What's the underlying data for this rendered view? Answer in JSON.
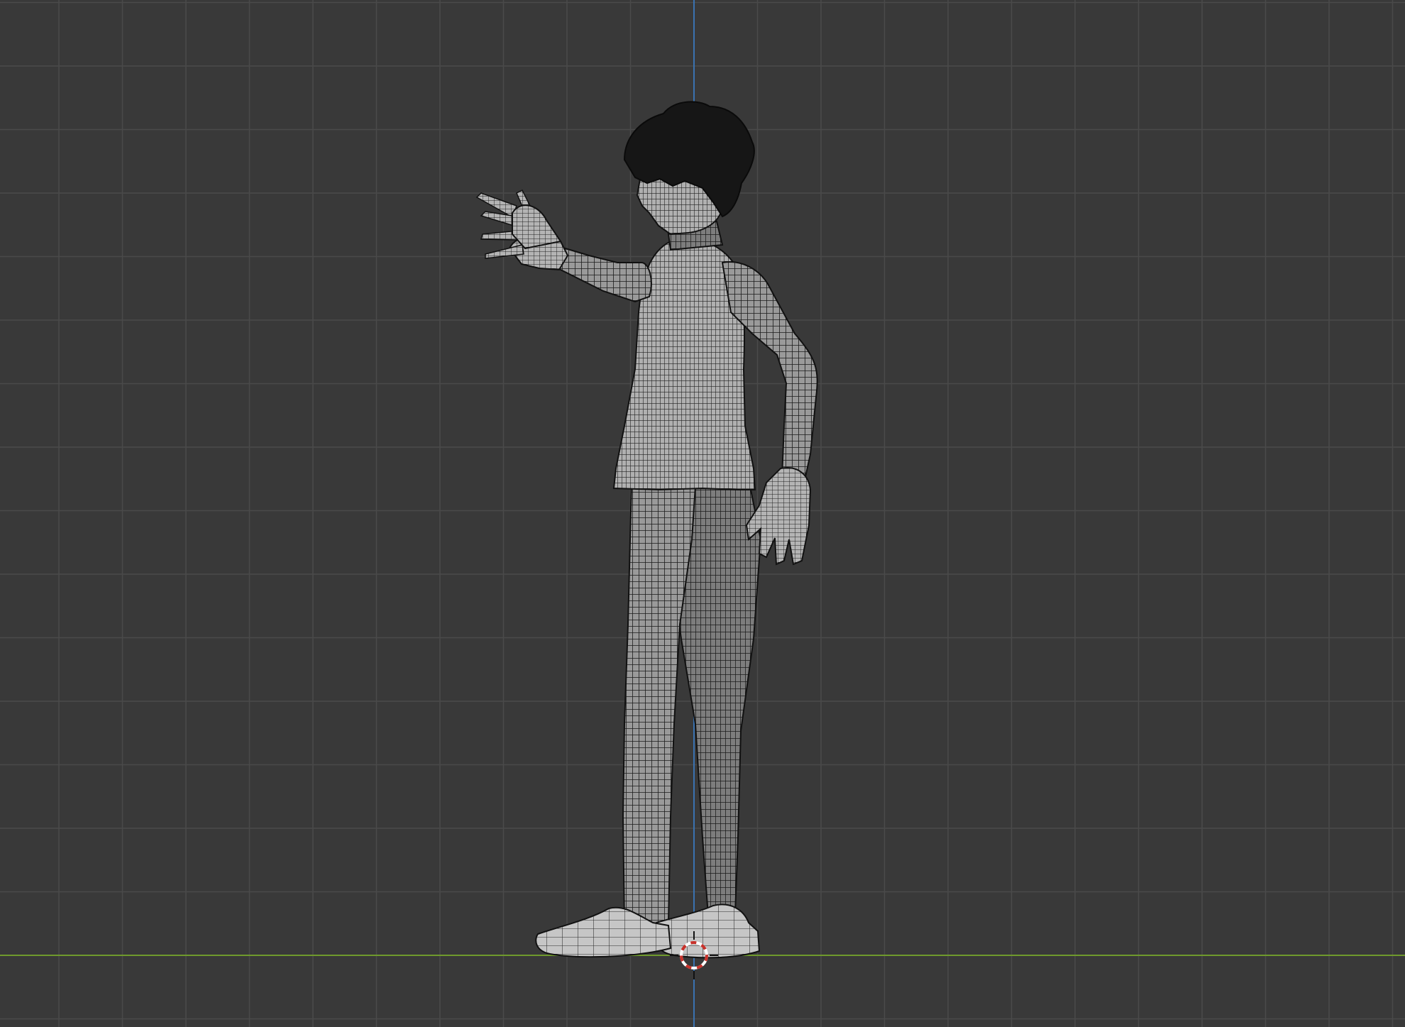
{
  "viewport": {
    "mode": "wireframe-overlay",
    "view": "side-orthographic",
    "colors": {
      "background": "#393939",
      "grid_minor": "#424242",
      "grid_major": "#4a4a4a",
      "axis_horizontal": "#6f9a2c",
      "axis_vertical": "#3a72b0",
      "mesh_fill": "#8c8c8c",
      "mesh_light": "#b9b9b9",
      "wire": "#1b1b1b",
      "hair": "#161616",
      "cursor_red": "#c8322b",
      "cursor_white": "#ffffff"
    }
  },
  "scene": {
    "object": "character-mesh",
    "icons": {
      "cursor": "3d-cursor-icon"
    }
  }
}
